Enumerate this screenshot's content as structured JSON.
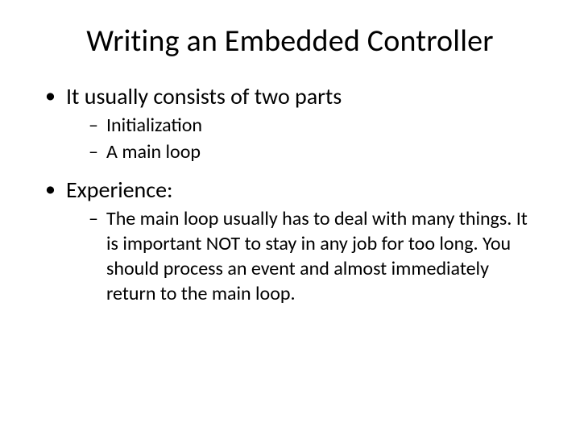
{
  "title": "Writing an Embedded Controller",
  "bullets": [
    {
      "text": "It usually consists of two parts",
      "sub": [
        "Initialization",
        "A  main loop"
      ]
    },
    {
      "text": "Experience:",
      "sub": [
        "The main loop usually has to deal with many things. It is important NOT to stay in any job for too long. You should process an event and almost immediately return to the main loop."
      ]
    }
  ]
}
